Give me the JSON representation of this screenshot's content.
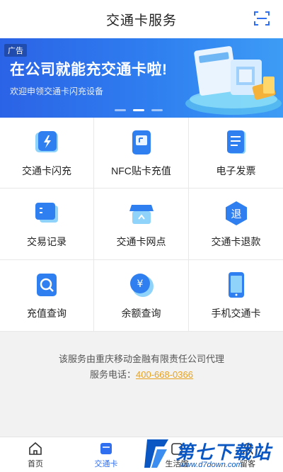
{
  "header": {
    "title": "交通卡服务",
    "scan_icon": "scan-icon"
  },
  "banner": {
    "ad_tag": "广告",
    "headline": "在公司就能充交通卡啦!",
    "subtitle": "欢迎申领交通卡闪充设备",
    "slide_count": 3,
    "active_slide": 1
  },
  "services": [
    {
      "label": "交通卡闪充",
      "icon": "flash-charge-icon"
    },
    {
      "label": "NFC贴卡充值",
      "icon": "nfc-icon"
    },
    {
      "label": "电子发票",
      "icon": "invoice-icon"
    },
    {
      "label": "交易记录",
      "icon": "records-icon"
    },
    {
      "label": "交通卡网点",
      "icon": "store-icon"
    },
    {
      "label": "交通卡退款",
      "icon": "refund-icon"
    },
    {
      "label": "充值查询",
      "icon": "recharge-query-icon"
    },
    {
      "label": "余额查询",
      "icon": "balance-icon"
    },
    {
      "label": "手机交通卡",
      "icon": "phone-card-icon"
    }
  ],
  "footer": {
    "agent_text": "该服务由重庆移动金融有限责任公司代理",
    "phone_label": "服务电话：",
    "phone_number": "400-668-0366"
  },
  "tabs": [
    {
      "label": "首页",
      "icon": "home-icon",
      "active": false
    },
    {
      "label": "交通卡",
      "icon": "card-icon",
      "active": true
    },
    {
      "label": "生活馆",
      "icon": "life-icon",
      "active": false
    },
    {
      "label": "留客",
      "icon": "guest-icon",
      "active": false
    }
  ],
  "watermark": {
    "text": "第七下载站",
    "url": "www.d7down.com"
  },
  "colors": {
    "accent": "#2f6ff0",
    "banner_start": "#2b63e6",
    "phone_link": "#e8a21d",
    "icon_blue": "#2f7ff0"
  }
}
